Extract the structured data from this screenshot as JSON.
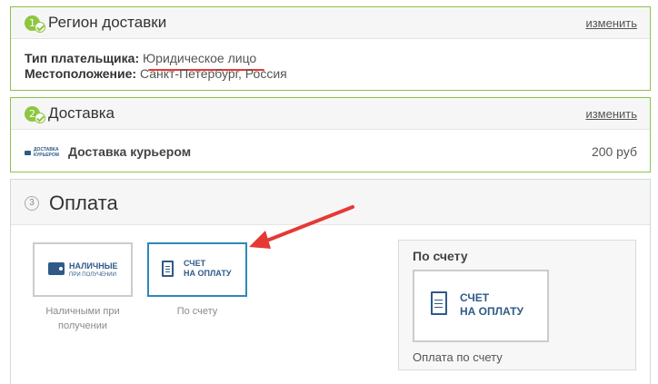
{
  "delivery_region": {
    "step": "1",
    "title": "Регион доставки",
    "change_link": "изменить",
    "payer_type_label": "Тип плательщика:",
    "payer_type_value": "Юридическое лицо",
    "location_label": "Местоположение:",
    "location_value": "Санкт-Петербург, Россия"
  },
  "delivery": {
    "step": "2",
    "title": "Доставка",
    "change_link": "изменить",
    "logo_line1": "ДОСТАВКА",
    "logo_line2": "КУРЬЕРОМ",
    "method_name": "Доставка курьером",
    "price": "200 руб"
  },
  "payment": {
    "step": "3",
    "title": "Оплата",
    "options": [
      {
        "logo_line1": "НАЛИЧНЫЕ",
        "logo_line2": "ПРИ ПОЛУЧЕНИИ",
        "caption": "Наличными при получении",
        "selected": false
      },
      {
        "logo_line1": "СЧЕТ",
        "logo_line2": "НА ОПЛАТУ",
        "caption": "По счету",
        "selected": true
      }
    ],
    "selected_panel": {
      "title": "По счету",
      "logo_line1": "СЧЕТ",
      "logo_line2": "НА ОПЛАТУ",
      "caption": "Оплата по счету"
    }
  },
  "colors": {
    "accent_green": "#8dc63f",
    "selected_border": "#2a8ab7",
    "annotation_red": "#e53935",
    "logo_blue": "#2f5a88"
  }
}
